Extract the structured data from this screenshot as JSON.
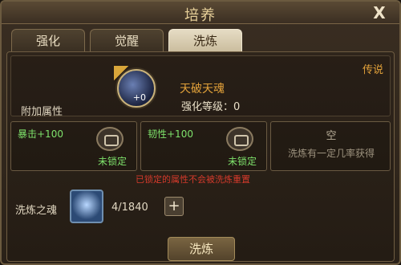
{
  "window": {
    "title": "培养",
    "close_label": "X"
  },
  "tabs": [
    {
      "label": "强化"
    },
    {
      "label": "觉醒"
    },
    {
      "label": "洗炼"
    }
  ],
  "item": {
    "name": "天破天魂",
    "enhance_level": "强化等级：0",
    "level_badge": "+0",
    "quality": "传说",
    "extra_attr_label": "附加属性"
  },
  "slots": [
    {
      "attribute": "暴击+100",
      "status": "未锁定"
    },
    {
      "attribute": "韧性+100",
      "status": "未锁定"
    },
    {
      "title": "空",
      "description": "洗炼有一定几率获得"
    }
  ],
  "warning": "已锁定的属性不会被洗炼重置",
  "material": {
    "label": "洗炼之魂",
    "count": "4/1840",
    "add_label": "+"
  },
  "actions": {
    "refine_label": "洗炼"
  }
}
